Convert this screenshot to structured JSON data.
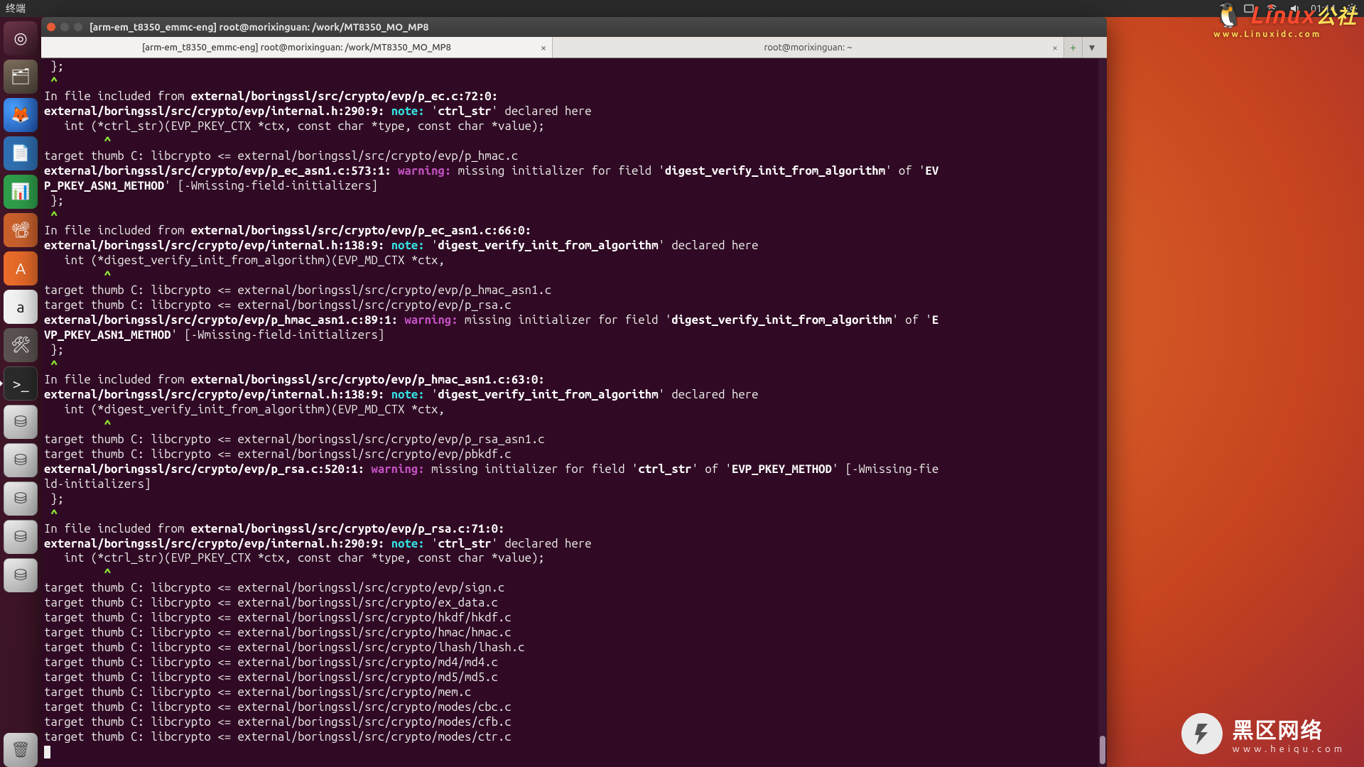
{
  "menubar": {
    "app_label": "终端",
    "time": "01:14"
  },
  "launcher": [
    {
      "name": "dash",
      "glyph": "◎",
      "cls": "li-dash"
    },
    {
      "name": "files",
      "glyph": "🗂",
      "cls": "li-files"
    },
    {
      "name": "firefox",
      "glyph": "🦊",
      "cls": "li-ff"
    },
    {
      "name": "writer",
      "glyph": "📄",
      "cls": "li-writer"
    },
    {
      "name": "calc",
      "glyph": "📊",
      "cls": "li-calc"
    },
    {
      "name": "impress",
      "glyph": "📽",
      "cls": "li-impress"
    },
    {
      "name": "software",
      "glyph": "A",
      "cls": "li-sw"
    },
    {
      "name": "amazon",
      "glyph": "a",
      "cls": "li-amz"
    },
    {
      "name": "settings",
      "glyph": "🛠",
      "cls": "li-settings"
    },
    {
      "name": "terminal",
      "glyph": ">_",
      "cls": "li-term",
      "active": true
    },
    {
      "name": "disk1",
      "glyph": "⛁",
      "cls": "li-disk"
    },
    {
      "name": "disk2",
      "glyph": "⛁",
      "cls": "li-disk"
    },
    {
      "name": "disk3",
      "glyph": "⛁",
      "cls": "li-disk"
    },
    {
      "name": "disk4",
      "glyph": "⛁",
      "cls": "li-disk"
    },
    {
      "name": "disk5",
      "glyph": "⛁",
      "cls": "li-disk"
    }
  ],
  "trash_glyph": "🗑",
  "window": {
    "title": "[arm-em_t8350_emmc-eng] root@morixinguan: /work/MT8350_MO_MP8",
    "tabs": [
      {
        "label": "[arm-em_t8350_emmc-eng] root@morixinguan: /work/MT8350_MO_MP8",
        "current": true
      },
      {
        "label": "root@morixinguan: ~",
        "current": false
      }
    ],
    "tab_add": "+",
    "tab_menu": "▾"
  },
  "watermarks": {
    "linux_tux": "🐧",
    "linux_text": "Linux",
    "linux_sub": "www.Linuxidc.com",
    "heiqu_glyph": "↯",
    "heiqu_text": "黑区网络",
    "heiqu_sub": "www.heiqu.com"
  },
  "lines": [
    [
      {
        "t": " };"
      }
    ],
    [
      {
        "cls": "green",
        "t": " ^"
      }
    ],
    [
      {
        "t": "In file included from "
      },
      {
        "cls": "b",
        "t": "external/boringssl/src/crypto/evp/p_ec.c:72:0:"
      }
    ],
    [
      {
        "cls": "b",
        "t": "external/boringssl/src/crypto/evp/internal.h:290:9: "
      },
      {
        "cls": "note",
        "t": "note: "
      },
      {
        "t": "'"
      },
      {
        "cls": "b",
        "t": "ctrl_str"
      },
      {
        "t": "' declared here"
      }
    ],
    [
      {
        "t": "   int (*ctrl_str)(EVP_PKEY_CTX *ctx, const char *type, const char *value);"
      }
    ],
    [
      {
        "cls": "green",
        "t": "         ^"
      }
    ],
    [
      {
        "t": "target thumb C: libcrypto <= external/boringssl/src/crypto/evp/p_hmac.c"
      }
    ],
    [
      {
        "cls": "b",
        "t": "external/boringssl/src/crypto/evp/p_ec_asn1.c:573:1: "
      },
      {
        "cls": "warn",
        "t": "warning: "
      },
      {
        "t": "missing initializer for field '"
      },
      {
        "cls": "b",
        "t": "digest_verify_init_from_algorithm"
      },
      {
        "t": "' of '"
      },
      {
        "cls": "b",
        "t": "EV"
      }
    ],
    [
      {
        "cls": "b",
        "t": "P_PKEY_ASN1_METHOD"
      },
      {
        "t": "' [-Wmissing-field-initializers]"
      }
    ],
    [
      {
        "t": " };"
      }
    ],
    [
      {
        "cls": "green",
        "t": " ^"
      }
    ],
    [
      {
        "t": "In file included from "
      },
      {
        "cls": "b",
        "t": "external/boringssl/src/crypto/evp/p_ec_asn1.c:66:0:"
      }
    ],
    [
      {
        "cls": "b",
        "t": "external/boringssl/src/crypto/evp/internal.h:138:9: "
      },
      {
        "cls": "note",
        "t": "note: "
      },
      {
        "t": "'"
      },
      {
        "cls": "b",
        "t": "digest_verify_init_from_algorithm"
      },
      {
        "t": "' declared here"
      }
    ],
    [
      {
        "t": "   int (*digest_verify_init_from_algorithm)(EVP_MD_CTX *ctx,"
      }
    ],
    [
      {
        "cls": "green",
        "t": "         ^"
      }
    ],
    [
      {
        "t": "target thumb C: libcrypto <= external/boringssl/src/crypto/evp/p_hmac_asn1.c"
      }
    ],
    [
      {
        "t": "target thumb C: libcrypto <= external/boringssl/src/crypto/evp/p_rsa.c"
      }
    ],
    [
      {
        "cls": "b",
        "t": "external/boringssl/src/crypto/evp/p_hmac_asn1.c:89:1: "
      },
      {
        "cls": "warn",
        "t": "warning: "
      },
      {
        "t": "missing initializer for field '"
      },
      {
        "cls": "b",
        "t": "digest_verify_init_from_algorithm"
      },
      {
        "t": "' of '"
      },
      {
        "cls": "b",
        "t": "E"
      }
    ],
    [
      {
        "cls": "b",
        "t": "VP_PKEY_ASN1_METHOD"
      },
      {
        "t": "' [-Wmissing-field-initializers]"
      }
    ],
    [
      {
        "t": " };"
      }
    ],
    [
      {
        "cls": "green",
        "t": " ^"
      }
    ],
    [
      {
        "t": "In file included from "
      },
      {
        "cls": "b",
        "t": "external/boringssl/src/crypto/evp/p_hmac_asn1.c:63:0:"
      }
    ],
    [
      {
        "cls": "b",
        "t": "external/boringssl/src/crypto/evp/internal.h:138:9: "
      },
      {
        "cls": "note",
        "t": "note: "
      },
      {
        "t": "'"
      },
      {
        "cls": "b",
        "t": "digest_verify_init_from_algorithm"
      },
      {
        "t": "' declared here"
      }
    ],
    [
      {
        "t": "   int (*digest_verify_init_from_algorithm)(EVP_MD_CTX *ctx,"
      }
    ],
    [
      {
        "cls": "green",
        "t": "         ^"
      }
    ],
    [
      {
        "t": "target thumb C: libcrypto <= external/boringssl/src/crypto/evp/p_rsa_asn1.c"
      }
    ],
    [
      {
        "t": "target thumb C: libcrypto <= external/boringssl/src/crypto/evp/pbkdf.c"
      }
    ],
    [
      {
        "cls": "b",
        "t": "external/boringssl/src/crypto/evp/p_rsa.c:520:1: "
      },
      {
        "cls": "warn",
        "t": "warning: "
      },
      {
        "t": "missing initializer for field '"
      },
      {
        "cls": "b",
        "t": "ctrl_str"
      },
      {
        "t": "' of '"
      },
      {
        "cls": "b",
        "t": "EVP_PKEY_METHOD"
      },
      {
        "t": "' [-Wmissing-fie"
      }
    ],
    [
      {
        "t": "ld-initializers]"
      }
    ],
    [
      {
        "t": " };"
      }
    ],
    [
      {
        "cls": "green",
        "t": " ^"
      }
    ],
    [
      {
        "t": "In file included from "
      },
      {
        "cls": "b",
        "t": "external/boringssl/src/crypto/evp/p_rsa.c:71:0:"
      }
    ],
    [
      {
        "cls": "b",
        "t": "external/boringssl/src/crypto/evp/internal.h:290:9: "
      },
      {
        "cls": "note",
        "t": "note: "
      },
      {
        "t": "'"
      },
      {
        "cls": "b",
        "t": "ctrl_str"
      },
      {
        "t": "' declared here"
      }
    ],
    [
      {
        "t": "   int (*ctrl_str)(EVP_PKEY_CTX *ctx, const char *type, const char *value);"
      }
    ],
    [
      {
        "cls": "green",
        "t": "         ^"
      }
    ],
    [
      {
        "t": "target thumb C: libcrypto <= external/boringssl/src/crypto/evp/sign.c"
      }
    ],
    [
      {
        "t": "target thumb C: libcrypto <= external/boringssl/src/crypto/ex_data.c"
      }
    ],
    [
      {
        "t": "target thumb C: libcrypto <= external/boringssl/src/crypto/hkdf/hkdf.c"
      }
    ],
    [
      {
        "t": "target thumb C: libcrypto <= external/boringssl/src/crypto/hmac/hmac.c"
      }
    ],
    [
      {
        "t": "target thumb C: libcrypto <= external/boringssl/src/crypto/lhash/lhash.c"
      }
    ],
    [
      {
        "t": "target thumb C: libcrypto <= external/boringssl/src/crypto/md4/md4.c"
      }
    ],
    [
      {
        "t": "target thumb C: libcrypto <= external/boringssl/src/crypto/md5/md5.c"
      }
    ],
    [
      {
        "t": "target thumb C: libcrypto <= external/boringssl/src/crypto/mem.c"
      }
    ],
    [
      {
        "t": "target thumb C: libcrypto <= external/boringssl/src/crypto/modes/cbc.c"
      }
    ],
    [
      {
        "t": "target thumb C: libcrypto <= external/boringssl/src/crypto/modes/cfb.c"
      }
    ],
    [
      {
        "t": "target thumb C: libcrypto <= external/boringssl/src/crypto/modes/ctr.c"
      }
    ]
  ]
}
